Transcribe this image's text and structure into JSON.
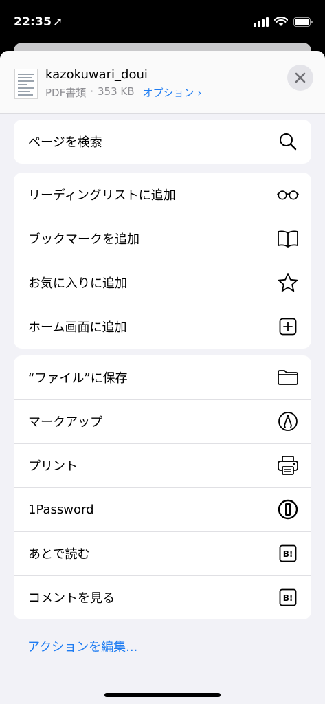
{
  "status_bar": {
    "time": "22:35",
    "location_glyph": "➚"
  },
  "header": {
    "file_name": "kazokuwari_doui",
    "file_type": "PDF書類",
    "separator": "·",
    "file_size": "353 KB",
    "options_label": "オプション ›",
    "close_icon": "close-icon"
  },
  "groups": [
    {
      "items": [
        {
          "label": "ページを検索",
          "icon": "search-icon"
        }
      ]
    },
    {
      "items": [
        {
          "label": "リーディングリストに追加",
          "icon": "glasses-icon"
        },
        {
          "label": "ブックマークを追加",
          "icon": "book-icon"
        },
        {
          "label": "お気に入りに追加",
          "icon": "star-icon"
        },
        {
          "label": "ホーム画面に追加",
          "icon": "plus-square-icon"
        }
      ]
    },
    {
      "items": [
        {
          "label": "“ファイル”に保存",
          "icon": "folder-icon"
        },
        {
          "label": "マークアップ",
          "icon": "markup-icon"
        },
        {
          "label": "プリント",
          "icon": "printer-icon"
        },
        {
          "label": "1Password",
          "icon": "1password-icon"
        },
        {
          "label": "あとで読む",
          "icon": "hatena-bookmark-icon",
          "icon_text": "B!"
        },
        {
          "label": "コメントを見る",
          "icon": "hatena-bookmark-icon",
          "icon_text": "B!"
        }
      ]
    }
  ],
  "edit_actions_label": "アクションを編集...",
  "colors": {
    "link": "#1e7cf2",
    "sheet_bg": "#f2f2f7",
    "meta_gray": "#8e8e93"
  }
}
